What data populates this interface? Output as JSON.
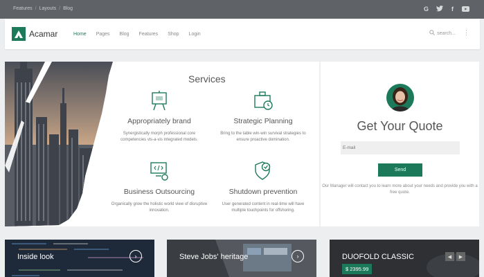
{
  "topbar": {
    "breadcrumbs": [
      "Features",
      "Layouts",
      "Blog"
    ],
    "social_icons": [
      "google-icon",
      "twitter-icon",
      "facebook-icon",
      "youtube-icon"
    ]
  },
  "navbar": {
    "logo_text": "Acamar",
    "menu": [
      "Home",
      "Pages",
      "Blog",
      "Features",
      "Shop",
      "Login"
    ],
    "active_menu": "Home",
    "search_placeholder": "search..."
  },
  "services": {
    "title": "Services",
    "items": [
      {
        "icon": "presentation-board-icon",
        "title": "Appropriately brand",
        "text": "Synergistically morph professional core competencies vis-a-vis integrated models."
      },
      {
        "icon": "briefcase-clock-icon",
        "title": "Strategic Planning",
        "text": "Bring to the table win-win survival strategies to ensure proactive domination."
      },
      {
        "icon": "monitor-code-icon",
        "title": "Business Outsourcing",
        "text": "Organically grow the holistic world view of disruptive innovation."
      },
      {
        "icon": "shield-check-icon",
        "title": "Shutdown prevention",
        "text": "User generated content in real-time will have multiple touchpoints for offshoring."
      }
    ]
  },
  "quote": {
    "title": "Get Your Quote",
    "email_placeholder": "E-mail",
    "send_label": "Send",
    "note": "Our Manager will contact you to learn more about your needs and provide you with a free quote."
  },
  "cards": [
    {
      "label": "Inside look"
    },
    {
      "label": "Steve Jobs' heritage"
    },
    {
      "label": "DUOFOLD CLASSIC",
      "price": "$ 2395.99"
    }
  ],
  "colors": {
    "accent": "#1c7a5a",
    "topbar": "#5f6266"
  }
}
